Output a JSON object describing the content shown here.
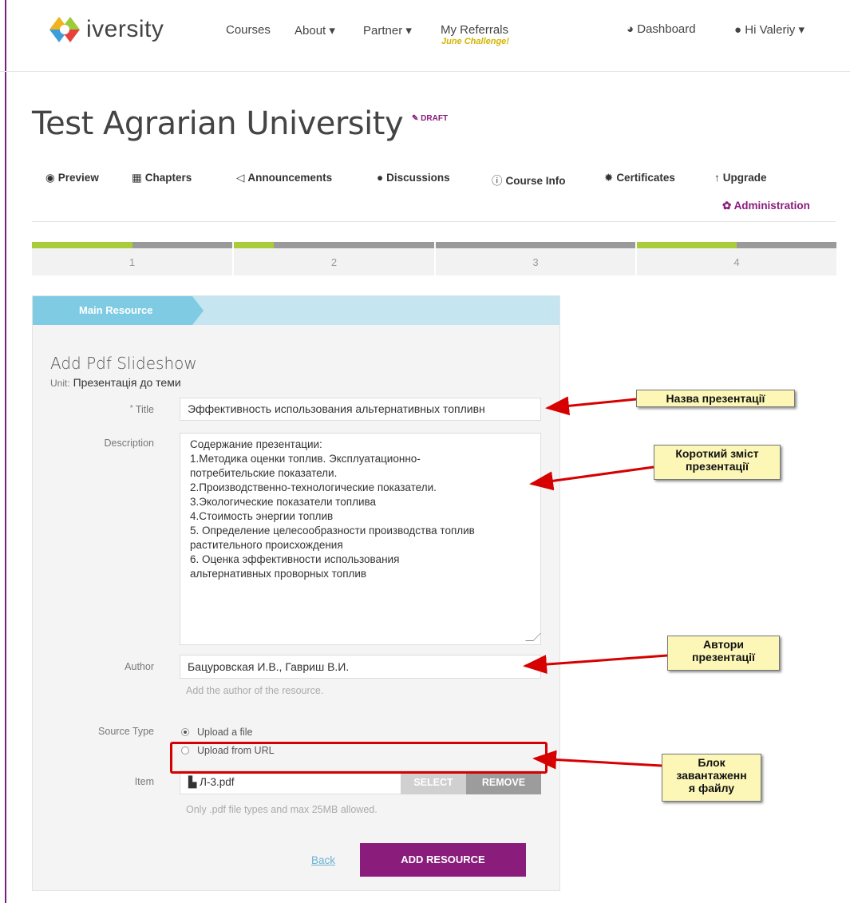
{
  "nav": {
    "logo_text": "iversity",
    "courses": "Courses",
    "about": "About ▾",
    "partner": "Partner ▾",
    "referrals": "My Referrals",
    "referrals_sub": "June Challenge!",
    "dashboard": "Dashboard",
    "user": "Hi Valeriy ▾"
  },
  "course": {
    "title": "Test Agrarian University",
    "status": "DRAFT"
  },
  "tabs": [
    {
      "icon": "eye-icon",
      "label": "Preview"
    },
    {
      "icon": "film-icon",
      "label": "Chapters"
    },
    {
      "icon": "megaphone-icon",
      "label": "Announcements"
    },
    {
      "icon": "speech-bubble-icon",
      "label": "Discussions"
    },
    {
      "icon": "info-icon",
      "label": "Course Info"
    },
    {
      "icon": "badge-icon",
      "label": "Certificates"
    },
    {
      "icon": "arrow-up-icon",
      "label": "Upgrade"
    },
    {
      "icon": "gear-icon",
      "label": "Administration"
    }
  ],
  "steps": [
    {
      "label": "1",
      "progress": 0.5
    },
    {
      "label": "2",
      "progress": 0.2
    },
    {
      "label": "3",
      "progress": 0
    },
    {
      "label": "4",
      "progress": 0.5
    }
  ],
  "form": {
    "breadcrumb": "Main Resource",
    "heading": "Add Pdf Slideshow",
    "unit_label": "Unit:",
    "unit_value": "Презентація до теми",
    "title_required": "*",
    "title_label": "Title",
    "title_value": "Эффективность использования альтернативных топливн",
    "description_label": "Description",
    "description_lines": [
      "Содержание презентации:",
      "",
      "1.Методика оценки топлив. Эксплуатационно-",
      "потребительские показатели.",
      "2.Производственно-технологические показатели.",
      "3.Экологические показатели топлива",
      "4.Стоимость энергии топлив",
      "5. Определение целесообразности производства топлив",
      "растительного происхождения",
      "6. Оценка эффективности использования",
      "альтернативных проворных топлив"
    ],
    "author_label": "Author",
    "author_value": "Бацуровская И.В., Гавриш В.И.",
    "author_help": "Add the author of the resource.",
    "source_type_label": "Source Type",
    "source_upload": "Upload a file",
    "source_url": "Upload from URL",
    "item_label": "Item",
    "item_file": "Л-3.pdf",
    "select_btn": "SELECT",
    "remove_btn": "REMOVE",
    "item_help": "Only .pdf file types and max 25MB allowed.",
    "back": "Back",
    "submit": "ADD RESOURCE"
  },
  "annotations": {
    "title_note": "Назва презентації",
    "description_note_1": "Короткий зміст",
    "description_note_2": "презентації",
    "author_note_1": "Автори",
    "author_note_2": "презентації",
    "upload_note_1": "Блок",
    "upload_note_2": "завантаженн",
    "upload_note_3": "я файлу"
  },
  "colors": {
    "brand": "#8a1c7c",
    "step_fill": "#a8cc3a",
    "breadcrumb": "#7fcbe4",
    "callout_bg": "#fcf7b6",
    "arrow": "#d60000"
  }
}
